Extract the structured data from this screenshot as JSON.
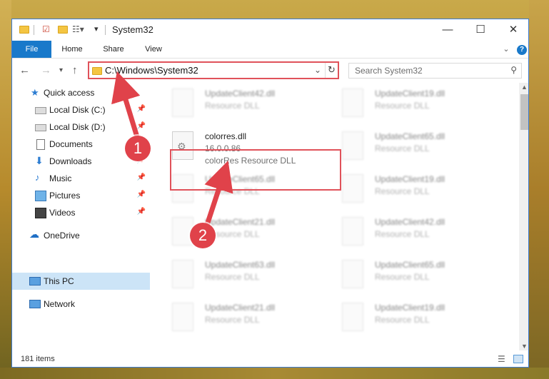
{
  "window": {
    "title": "System32"
  },
  "window_controls": {
    "minimize": "—",
    "maximize": "☐",
    "close": "✕"
  },
  "ribbon": {
    "tabs": [
      "File",
      "Home",
      "Share",
      "View"
    ]
  },
  "address": {
    "path": "C:\\Windows\\System32",
    "search_placeholder": "Search System32"
  },
  "nav": {
    "items": [
      {
        "label": "Quick access",
        "icon": "star-icon"
      },
      {
        "label": "Local Disk (C:)",
        "icon": "drive-icon"
      },
      {
        "label": "Local Disk (D:)",
        "icon": "drive-icon"
      },
      {
        "label": "Documents",
        "icon": "documents-icon"
      },
      {
        "label": "Downloads",
        "icon": "download-icon"
      },
      {
        "label": "Music",
        "icon": "music-icon"
      },
      {
        "label": "Pictures",
        "icon": "pictures-icon"
      },
      {
        "label": "Videos",
        "icon": "videos-icon"
      },
      {
        "label": "OneDrive",
        "icon": "cloud-icon"
      },
      {
        "label": "This PC",
        "icon": "pc-icon"
      },
      {
        "label": "Network",
        "icon": "network-icon"
      }
    ]
  },
  "files": {
    "highlighted": {
      "name": "colorres.dll",
      "version": "16.0.0.86",
      "description": "colorRes Resource DLL"
    },
    "items": [
      {
        "name": "UpdateClient42.dll",
        "description": "Resource DLL"
      },
      {
        "name": "UpdateClient19.dll",
        "description": "Resource DLL"
      },
      {
        "name": "UpdateClient65.dll",
        "description": "Resource DLL"
      },
      {
        "name": "UpdateClient65.dll",
        "description": "Resource DLL"
      },
      {
        "name": "UpdateClient19.dll",
        "description": "Resource DLL"
      },
      {
        "name": "UpdateClient21.dll",
        "description": "Resource DLL"
      },
      {
        "name": "UpdateClient42.dll",
        "description": "Resource DLL"
      },
      {
        "name": "UpdateClient63.dll",
        "description": "Resource DLL"
      },
      {
        "name": "UpdateClient65.dll",
        "description": "Resource DLL"
      },
      {
        "name": "UpdateClient21.dll",
        "description": "Resource DLL"
      },
      {
        "name": "UpdateClient19.dll",
        "description": "Resource DLL"
      }
    ]
  },
  "status": {
    "item_count": "181 items"
  },
  "callouts": [
    "1",
    "2"
  ],
  "colors": {
    "accent": "#1979ca",
    "highlight_border": "#e0525a",
    "callout": "#e0424a"
  }
}
